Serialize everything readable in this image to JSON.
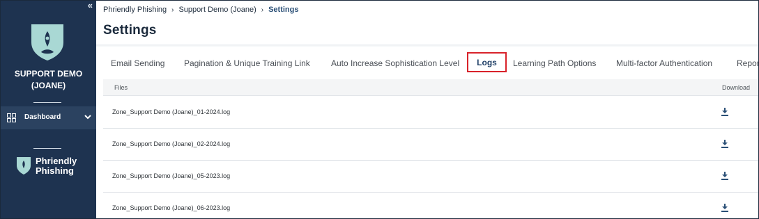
{
  "sidebar": {
    "collapse_glyph": "«",
    "org_name_line1": "SUPPORT DEMO",
    "org_name_line2": "(JOANE)",
    "nav": [
      {
        "label": "Dashboard",
        "icon": "dashboard-grid-icon"
      }
    ],
    "brand_line1": "Phriendly",
    "brand_line2": "Phishing"
  },
  "breadcrumb": {
    "items": [
      "Phriendly Phishing",
      "Support Demo (Joane)"
    ],
    "current": "Settings",
    "separator": "›"
  },
  "page": {
    "title": "Settings"
  },
  "tabs": [
    {
      "label": "Email Sending",
      "active": false
    },
    {
      "label": "Pagination & Unique Training Link",
      "active": false
    },
    {
      "label": "Auto Increase Sophistication Level",
      "active": false
    },
    {
      "label": "Logs",
      "active": true
    },
    {
      "label": "Learning Path Options",
      "active": false
    },
    {
      "label": "Multi-factor Authentication",
      "active": false
    },
    {
      "label": "Repor",
      "active": false
    }
  ],
  "table": {
    "col_files": "Files",
    "col_download": "Download",
    "rows": [
      {
        "file": "Zone_Support Demo (Joane)_01-2024.log"
      },
      {
        "file": "Zone_Support Demo (Joane)_02-2024.log"
      },
      {
        "file": "Zone_Support Demo (Joane)_05-2023.log"
      },
      {
        "file": "Zone_Support Demo (Joane)_06-2023.log"
      }
    ]
  },
  "colors": {
    "sidebar_bg": "#1e3350",
    "accent": "#2a4f76",
    "active_tab_border": "#d8222a",
    "shield": "#a9d8d4"
  }
}
